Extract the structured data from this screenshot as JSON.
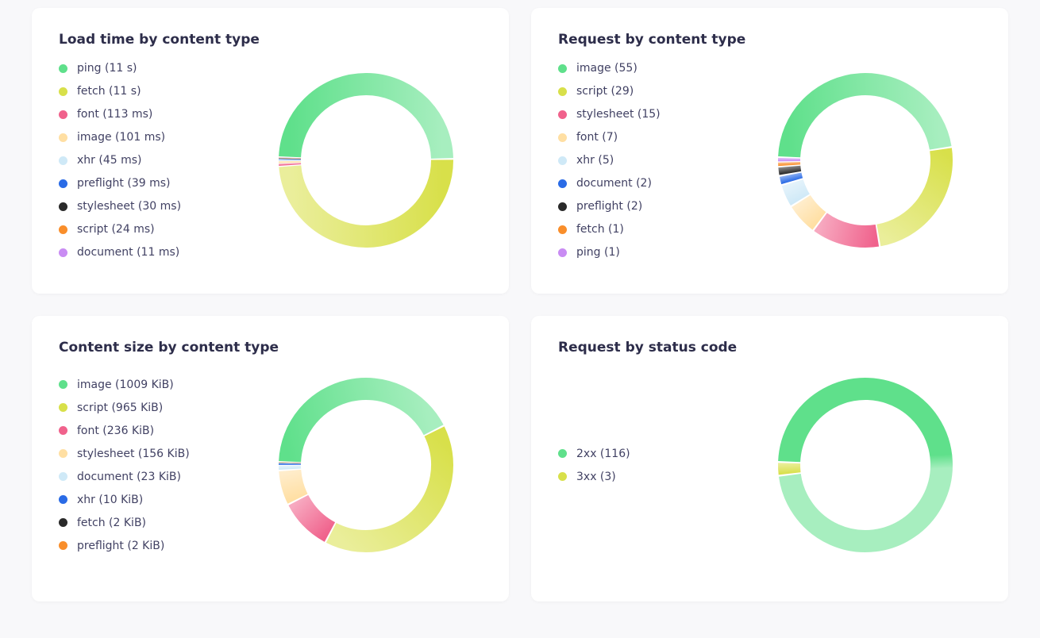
{
  "palette": {
    "green": "#5fe08b",
    "olive": "#d8e04a",
    "pink": "#f0628c",
    "peach": "#ffdfa3",
    "lightblue": "#cfe9f7",
    "blue": "#2a6be6",
    "black": "#2a2a2a",
    "orange": "#f98e2b",
    "violet": "#c98cf3",
    "grey": "#bcbcbc"
  },
  "panels": {
    "load_time": {
      "title": "Load time by content type",
      "items": [
        {
          "label": "ping (11 s)",
          "color": "green",
          "value": 11000
        },
        {
          "label": "fetch (11 s)",
          "color": "olive",
          "value": 11000
        },
        {
          "label": "font (113 ms)",
          "color": "pink",
          "value": 113
        },
        {
          "label": "image (101 ms)",
          "color": "peach",
          "value": 101
        },
        {
          "label": "xhr (45 ms)",
          "color": "lightblue",
          "value": 45
        },
        {
          "label": "preflight (39 ms)",
          "color": "blue",
          "value": 39
        },
        {
          "label": "stylesheet (30 ms)",
          "color": "black",
          "value": 30
        },
        {
          "label": "script (24 ms)",
          "color": "orange",
          "value": 24
        },
        {
          "label": "document (11 ms)",
          "color": "violet",
          "value": 11
        }
      ]
    },
    "request_type": {
      "title": "Request by content type",
      "items": [
        {
          "label": "image (55)",
          "color": "green",
          "value": 55
        },
        {
          "label": "script (29)",
          "color": "olive",
          "value": 29
        },
        {
          "label": "stylesheet (15)",
          "color": "pink",
          "value": 15
        },
        {
          "label": "font (7)",
          "color": "peach",
          "value": 7
        },
        {
          "label": "xhr (5)",
          "color": "lightblue",
          "value": 5
        },
        {
          "label": "document (2)",
          "color": "blue",
          "value": 2
        },
        {
          "label": "preflight (2)",
          "color": "black",
          "value": 2
        },
        {
          "label": "fetch (1)",
          "color": "orange",
          "value": 1
        },
        {
          "label": "ping (1)",
          "color": "violet",
          "value": 1
        }
      ]
    },
    "content_size": {
      "title": "Content size by content type",
      "items": [
        {
          "label": "image (1009 KiB)",
          "color": "green",
          "value": 1009
        },
        {
          "label": "script (965 KiB)",
          "color": "olive",
          "value": 965
        },
        {
          "label": "font (236 KiB)",
          "color": "pink",
          "value": 236
        },
        {
          "label": "stylesheet (156 KiB)",
          "color": "peach",
          "value": 156
        },
        {
          "label": "document (23 KiB)",
          "color": "lightblue",
          "value": 23
        },
        {
          "label": "xhr (10 KiB)",
          "color": "blue",
          "value": 10
        },
        {
          "label": "fetch (2 KiB)",
          "color": "black",
          "value": 2
        },
        {
          "label": "preflight (2 KiB)",
          "color": "orange",
          "value": 2
        }
      ]
    },
    "status_code": {
      "title": "Request by status code",
      "items": [
        {
          "label": "2xx (116)",
          "color": "green",
          "value": 116
        },
        {
          "label": "3xx (3)",
          "color": "olive",
          "value": 3
        }
      ]
    }
  },
  "chart_data": [
    {
      "type": "pie",
      "title": "Load time by content type",
      "series": [
        {
          "name": "ping",
          "value_ms": 11000
        },
        {
          "name": "fetch",
          "value_ms": 11000
        },
        {
          "name": "font",
          "value_ms": 113
        },
        {
          "name": "image",
          "value_ms": 101
        },
        {
          "name": "xhr",
          "value_ms": 45
        },
        {
          "name": "preflight",
          "value_ms": 39
        },
        {
          "name": "stylesheet",
          "value_ms": 30
        },
        {
          "name": "script",
          "value_ms": 24
        },
        {
          "name": "document",
          "value_ms": 11
        }
      ]
    },
    {
      "type": "pie",
      "title": "Request by content type",
      "series": [
        {
          "name": "image",
          "value": 55
        },
        {
          "name": "script",
          "value": 29
        },
        {
          "name": "stylesheet",
          "value": 15
        },
        {
          "name": "font",
          "value": 7
        },
        {
          "name": "xhr",
          "value": 5
        },
        {
          "name": "document",
          "value": 2
        },
        {
          "name": "preflight",
          "value": 2
        },
        {
          "name": "fetch",
          "value": 1
        },
        {
          "name": "ping",
          "value": 1
        }
      ]
    },
    {
      "type": "pie",
      "title": "Content size by content type",
      "series": [
        {
          "name": "image",
          "value_kib": 1009
        },
        {
          "name": "script",
          "value_kib": 965
        },
        {
          "name": "font",
          "value_kib": 236
        },
        {
          "name": "stylesheet",
          "value_kib": 156
        },
        {
          "name": "document",
          "value_kib": 23
        },
        {
          "name": "xhr",
          "value_kib": 10
        },
        {
          "name": "fetch",
          "value_kib": 2
        },
        {
          "name": "preflight",
          "value_kib": 2
        }
      ]
    },
    {
      "type": "pie",
      "title": "Request by status code",
      "series": [
        {
          "name": "2xx",
          "value": 116
        },
        {
          "name": "3xx",
          "value": 3
        }
      ]
    }
  ],
  "chart_render": {
    "outer_radius": 110,
    "inner_radius": 82,
    "start_angle_deg": -88,
    "gap_deg": 1.2
  }
}
